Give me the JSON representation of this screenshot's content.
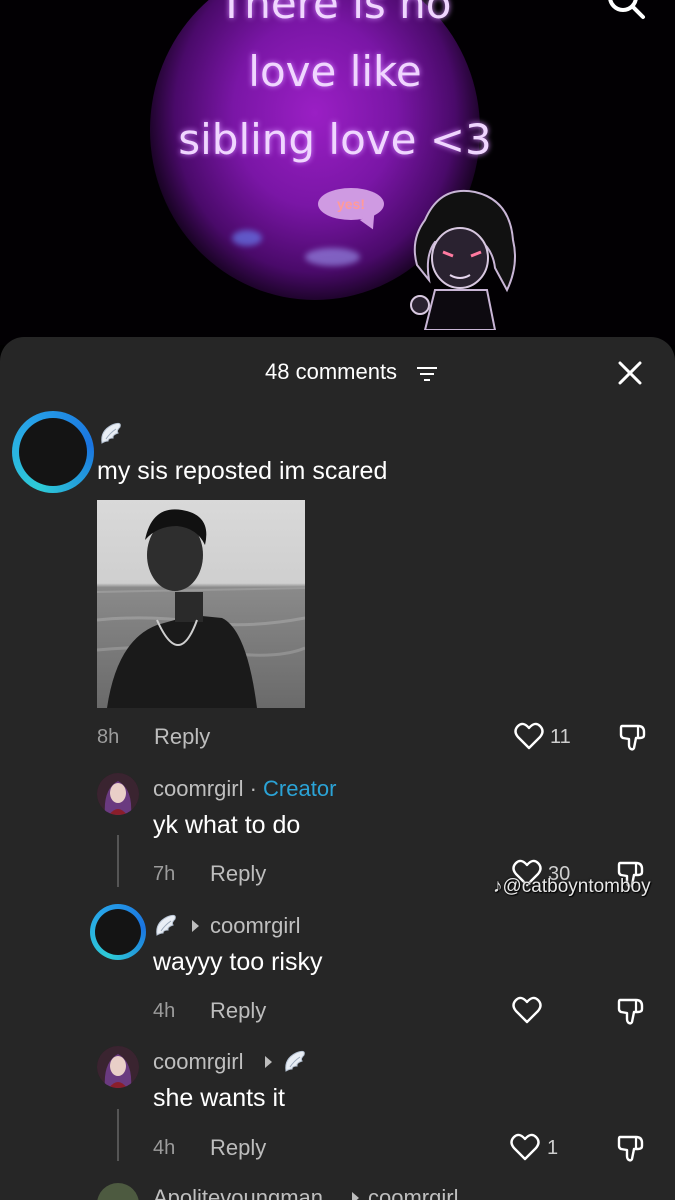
{
  "video": {
    "caption_lines": [
      "There is no",
      "love like",
      "sibling love <3"
    ],
    "sticker_text": "yes!"
  },
  "sheet": {
    "comment_count_label": "48 comments"
  },
  "comments": [
    {
      "text": "my sis reposted im scared",
      "time": "8h",
      "reply_label": "Reply",
      "likes": "11"
    },
    {
      "username": "coomrgirl",
      "separator": "·",
      "badge": "Creator",
      "text": "yk what to do",
      "time": "7h",
      "reply_label": "Reply",
      "likes": "30"
    },
    {
      "reply_to": "coomrgirl",
      "text": "wayyy too risky",
      "time": "4h",
      "reply_label": "Reply",
      "likes": ""
    },
    {
      "username": "coomrgirl",
      "text": "she wants it",
      "time": "4h",
      "reply_label": "Reply",
      "likes": "1"
    },
    {
      "username": "Apolitevoungman",
      "reply_to": "coomrgirl"
    }
  ],
  "watermark": "@catboyntomboy",
  "colors": {
    "sheet_bg": "#262626",
    "creator_badge": "#2ba3d6",
    "avatar_ring": "#27a3e8"
  },
  "icons": [
    "search-icon",
    "filter-icon",
    "close-icon",
    "angel-wing-icon",
    "heart-icon",
    "dislike-icon",
    "reply-arrow-icon",
    "tiktok-logo-icon"
  ]
}
